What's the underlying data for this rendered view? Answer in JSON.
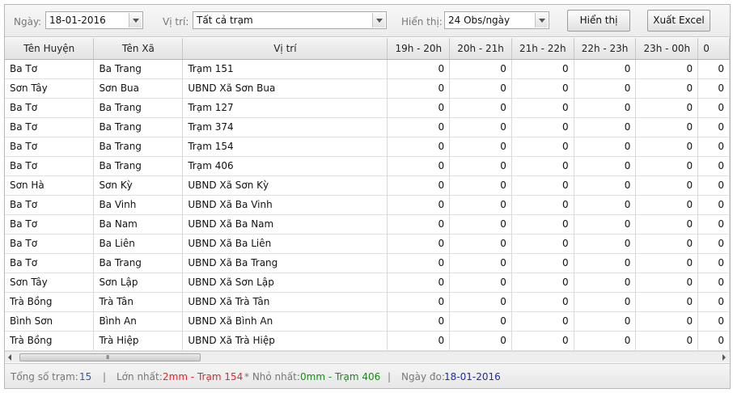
{
  "toolbar": {
    "date_label": "Ngày:",
    "date_value": "18-01-2016",
    "location_label": "Vị trí:",
    "location_value": "Tất cả trạm",
    "display_label": "Hiển thị:",
    "display_value": "24 Obs/ngày",
    "show_button": "Hiển thị",
    "export_button": "Xuất Excel"
  },
  "table": {
    "headers": [
      "Tên Huyện",
      "Tên Xã",
      "Vị trí",
      "19h - 20h",
      "20h - 21h",
      "21h - 22h",
      "22h - 23h",
      "23h - 00h",
      "0"
    ],
    "rows": [
      [
        "Ba Tơ",
        "Ba Trang",
        "Trạm 151",
        "0",
        "0",
        "0",
        "0",
        "0",
        "0"
      ],
      [
        "Sơn Tây",
        "Sơn Bua",
        "UBND Xã Sơn Bua",
        "0",
        "0",
        "0",
        "0",
        "0",
        "0"
      ],
      [
        "Ba Tơ",
        "Ba Trang",
        "Trạm 127",
        "0",
        "0",
        "0",
        "0",
        "0",
        "0"
      ],
      [
        "Ba Tơ",
        "Ba Trang",
        "Trạm 374",
        "0",
        "0",
        "0",
        "0",
        "0",
        "0"
      ],
      [
        "Ba Tơ",
        "Ba Trang",
        "Trạm 154",
        "0",
        "0",
        "0",
        "0",
        "0",
        "0"
      ],
      [
        "Ba Tơ",
        "Ba Trang",
        "Trạm 406",
        "0",
        "0",
        "0",
        "0",
        "0",
        "0"
      ],
      [
        "Sơn Hà",
        "Sơn Kỳ",
        "UBND Xã Sơn Kỳ",
        "0",
        "0",
        "0",
        "0",
        "0",
        "0"
      ],
      [
        "Ba Tơ",
        "Ba Vinh",
        "UBND Xã Ba Vinh",
        "0",
        "0",
        "0",
        "0",
        "0",
        "0"
      ],
      [
        "Ba Tơ",
        "Ba Nam",
        "UBND Xã Ba Nam",
        "0",
        "0",
        "0",
        "0",
        "0",
        "0"
      ],
      [
        "Ba Tơ",
        "Ba Liên",
        "UBND Xã Ba Liên",
        "0",
        "0",
        "0",
        "0",
        "0",
        "0"
      ],
      [
        "Ba Tơ",
        "Ba Trang",
        "UBND Xã Ba Trang",
        "0",
        "0",
        "0",
        "0",
        "0",
        "0"
      ],
      [
        "Sơn Tây",
        "Sơn Lập",
        "UBND Xã Sơn Lập",
        "0",
        "0",
        "0",
        "0",
        "0",
        "0"
      ],
      [
        "Trà Bồng",
        "Trà Tân",
        "UBND Xã Trà Tân",
        "0",
        "0",
        "0",
        "0",
        "0",
        "0"
      ],
      [
        "Bình Sơn",
        "Bình An",
        "UBND Xã Bình An",
        "0",
        "0",
        "0",
        "0",
        "0",
        "0"
      ],
      [
        "Trà Bồng",
        "Trà Hiệp",
        "UBND Xã Trà Hiệp",
        "0",
        "0",
        "0",
        "0",
        "0",
        "0"
      ]
    ]
  },
  "scrollbar": {
    "grip": "III"
  },
  "status": {
    "total_label": "Tổng số trạm:",
    "total_value": "15",
    "sep1": "|",
    "max_label": "Lớn nhất:",
    "max_value": "2mm - Trạm 154",
    "min_label": "* Nhỏ nhất:",
    "min_value": "0mm - Trạm 406",
    "sep2": "|",
    "date_label": "Ngày đo:",
    "date_value": "18-01-2016"
  },
  "colors": {
    "count": "#2d5fa8",
    "max": "#e0282a",
    "min": "#1a8a1a",
    "date": "#1c2f9c"
  },
  "icons": {
    "dropdown": "chevron-down-icon",
    "scroll_left": "arrow-left-icon",
    "scroll_right": "arrow-right-icon"
  }
}
